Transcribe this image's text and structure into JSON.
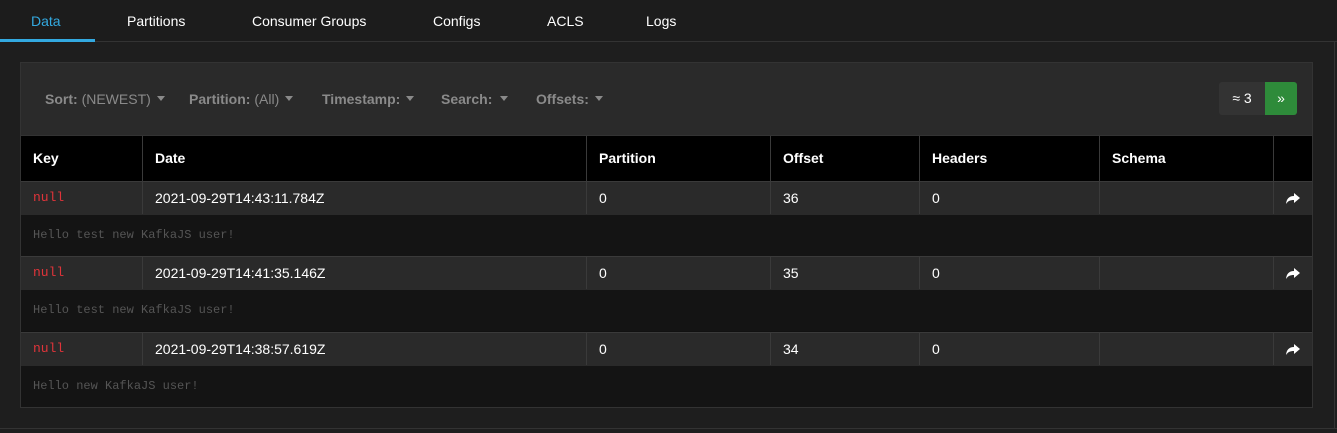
{
  "tabs": [
    {
      "label": "Data",
      "active": true
    },
    {
      "label": "Partitions"
    },
    {
      "label": "Consumer Groups"
    },
    {
      "label": "Configs"
    },
    {
      "label": "ACLS"
    },
    {
      "label": "Logs"
    }
  ],
  "toolbar": {
    "sort": {
      "label": "Sort:",
      "value": "(NEWEST)"
    },
    "partition": {
      "label": "Partition:",
      "value": "(All)"
    },
    "timestamp": {
      "label": "Timestamp:"
    },
    "search": {
      "label": "Search:"
    },
    "offsets": {
      "label": "Offsets:"
    },
    "count_label": "≈ 3",
    "next_label": "»"
  },
  "table": {
    "columns": [
      "Key",
      "Date",
      "Partition",
      "Offset",
      "Headers",
      "Schema"
    ],
    "rows": [
      {
        "key": "null",
        "date": "2021-09-29T14:43:11.784Z",
        "partition": "0",
        "offset": "36",
        "headers": "0",
        "schema": "",
        "message": "Hello test new KafkaJS user!"
      },
      {
        "key": "null",
        "date": "2021-09-29T14:41:35.146Z",
        "partition": "0",
        "offset": "35",
        "headers": "0",
        "schema": "",
        "message": "Hello test new KafkaJS user!"
      },
      {
        "key": "null",
        "date": "2021-09-29T14:38:57.619Z",
        "partition": "0",
        "offset": "34",
        "headers": "0",
        "schema": "",
        "message": "Hello new KafkaJS user!"
      }
    ]
  },
  "colors": {
    "accent": "#33a9e0",
    "key_null": "#e0343a",
    "next_button": "#2e8b3a"
  },
  "icons": {
    "row_action": "share-forward-icon"
  }
}
